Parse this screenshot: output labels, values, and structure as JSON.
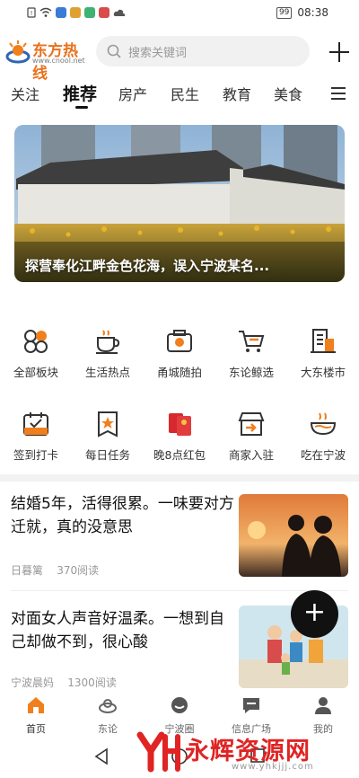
{
  "status_bar": {
    "time": "08:38",
    "battery": "99",
    "icons": [
      "sim-alert-icon",
      "wifi-icon",
      "app-notification-icon",
      "app-notification-icon",
      "app-notification-icon",
      "app-notification-icon",
      "cloud-icon"
    ]
  },
  "header": {
    "logo_name": "东方热线",
    "logo_url": "www.cnool.net",
    "search_placeholder": "搜索关键词",
    "add_icon": "plus-icon"
  },
  "tabs": [
    {
      "label": "关注"
    },
    {
      "label": "推荐",
      "active": true
    },
    {
      "label": "房产"
    },
    {
      "label": "民生"
    },
    {
      "label": "教育"
    },
    {
      "label": "美食"
    }
  ],
  "banner": {
    "caption": "探营奉化江畔金色花海，误入宁波某名..."
  },
  "quick_links_row1": [
    {
      "label": "全部板块",
      "icon": "grid-blocks-icon"
    },
    {
      "label": "生活热点",
      "icon": "coffee-cup-icon"
    },
    {
      "label": "甬城随拍",
      "icon": "camera-icon"
    },
    {
      "label": "东论鲸选",
      "icon": "shopping-cart-icon"
    },
    {
      "label": "大东楼市",
      "icon": "building-icon"
    }
  ],
  "quick_links_row2": [
    {
      "label": "签到打卡",
      "icon": "calendar-check-icon"
    },
    {
      "label": "每日任务",
      "icon": "task-badge-icon"
    },
    {
      "label": "晚8点红包",
      "icon": "red-envelope-icon"
    },
    {
      "label": "商家入驻",
      "icon": "store-icon"
    },
    {
      "label": "吃在宁波",
      "icon": "noodle-bowl-icon"
    }
  ],
  "articles": [
    {
      "title": "结婚5年，活得很累。一味要对方迁就，真的没意思",
      "author": "日暮篱",
      "reads": "370阅读"
    },
    {
      "title": "对面女人声音好温柔。一想到自己却做不到，很心酸",
      "author": "宁波晨妈",
      "reads": "1300阅读"
    }
  ],
  "fab": {
    "label": "+"
  },
  "bottom_nav": [
    {
      "label": "首页",
      "icon": "home-icon",
      "active": true
    },
    {
      "label": "东论",
      "icon": "forum-logo-icon"
    },
    {
      "label": "宁波圈",
      "icon": "circle-chat-icon"
    },
    {
      "label": "信息广场",
      "icon": "message-square-icon"
    },
    {
      "label": "我的",
      "icon": "user-icon"
    }
  ],
  "watermark": {
    "text": "永辉资源网",
    "url": "www.yhkjjj.com"
  },
  "colors": {
    "accent": "#f07f1d",
    "watermark": "#e02424"
  }
}
